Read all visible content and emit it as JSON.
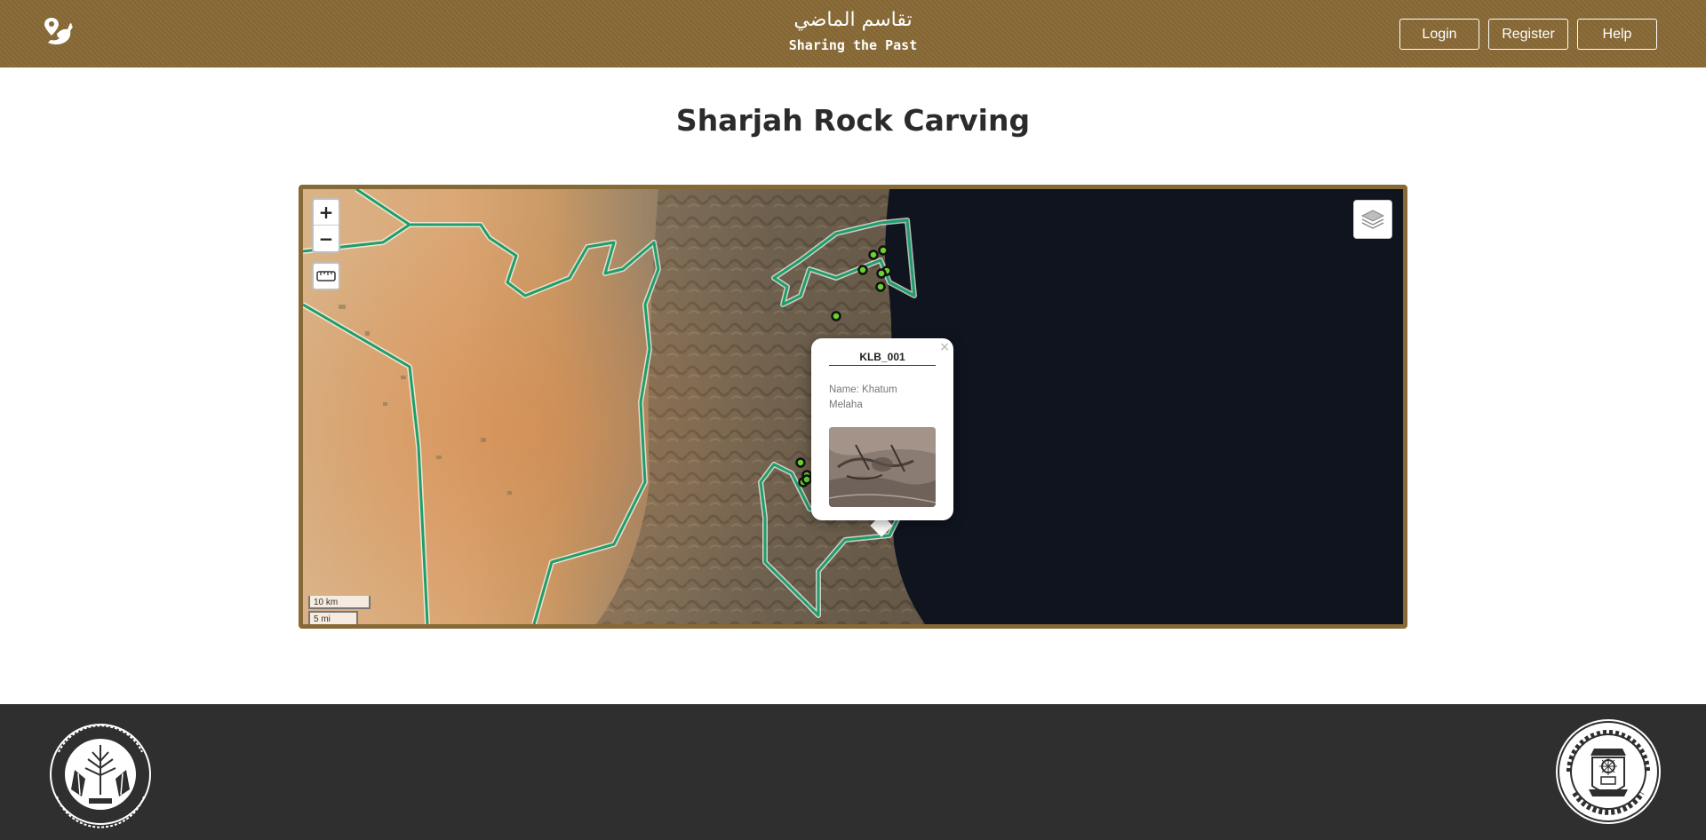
{
  "header": {
    "title_ar": "تقاسم الماضي",
    "title_en": "Sharing the Past",
    "buttons": {
      "login": "Login",
      "register": "Register",
      "help": "Help"
    },
    "color": "#876935"
  },
  "page": {
    "title": "Sharjah Rock Carving"
  },
  "map": {
    "zoom_in": "+",
    "zoom_out": "−",
    "scale": {
      "km": "10 km",
      "mi": "5 mi"
    },
    "popup": {
      "title": "KLB_001",
      "name_label": "Name: Khatum Melaha",
      "close": "×"
    },
    "boundary_color": "#2aa36b",
    "marker_color": "#6bd12f"
  },
  "footer": {
    "color": "#2f2f2f"
  }
}
